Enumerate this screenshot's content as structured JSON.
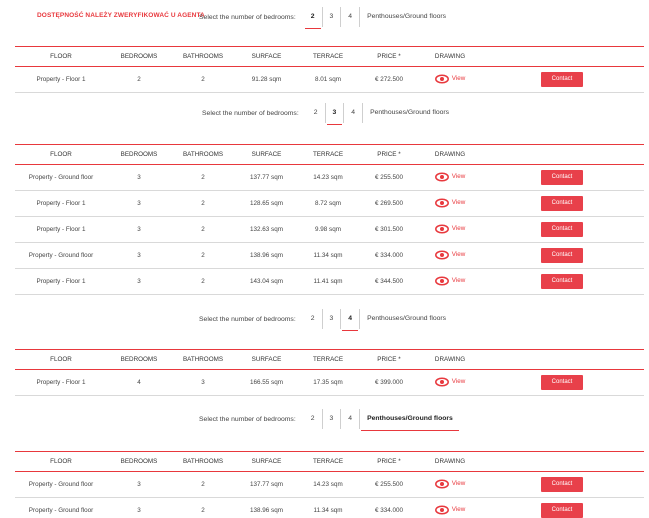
{
  "notice": "DOSTĘPNOŚĆ NALEŻY ZWERYFIKOWAĆ U AGENTA",
  "selector": {
    "label": "Select the number of bedrooms:",
    "options": [
      "2",
      "3",
      "4",
      "Penthouses/Ground floors"
    ]
  },
  "columns": [
    "FLOOR",
    "BEDROOMS",
    "BATHROOMS",
    "SURFACE",
    "TERRACE",
    "PRICE *",
    "DRAWING"
  ],
  "view_label": "View",
  "contact_label": "Contact",
  "sections": [
    {
      "active_option": "2",
      "rows": [
        {
          "floor": "Property - Floor 1",
          "bedrooms": "2",
          "bathrooms": "2",
          "surface": "91.28 sqm",
          "terrace": "8.01 sqm",
          "price": "€ 272.500"
        }
      ]
    },
    {
      "active_option": "3",
      "rows": [
        {
          "floor": "Property - Ground floor",
          "bedrooms": "3",
          "bathrooms": "2",
          "surface": "137.77 sqm",
          "terrace": "14.23 sqm",
          "price": "€ 255.500"
        },
        {
          "floor": "Property - Floor 1",
          "bedrooms": "3",
          "bathrooms": "2",
          "surface": "128.65 sqm",
          "terrace": "8.72 sqm",
          "price": "€ 269.500"
        },
        {
          "floor": "Property - Floor 1",
          "bedrooms": "3",
          "bathrooms": "2",
          "surface": "132.63 sqm",
          "terrace": "9.98 sqm",
          "price": "€ 301.500"
        },
        {
          "floor": "Property - Ground floor",
          "bedrooms": "3",
          "bathrooms": "2",
          "surface": "138.96 sqm",
          "terrace": "11.34 sqm",
          "price": "€ 334.000"
        },
        {
          "floor": "Property - Floor 1",
          "bedrooms": "3",
          "bathrooms": "2",
          "surface": "143.04 sqm",
          "terrace": "11.41 sqm",
          "price": "€ 344.500"
        }
      ]
    },
    {
      "active_option": "4",
      "rows": [
        {
          "floor": "Property - Floor 1",
          "bedrooms": "4",
          "bathrooms": "3",
          "surface": "166.55 sqm",
          "terrace": "17.35 sqm",
          "price": "€ 399.000"
        }
      ]
    },
    {
      "active_option": "Penthouses/Ground floors",
      "rows": [
        {
          "floor": "Property - Ground floor",
          "bedrooms": "3",
          "bathrooms": "2",
          "surface": "137.77 sqm",
          "terrace": "14.23 sqm",
          "price": "€ 255.500"
        },
        {
          "floor": "Property - Ground floor",
          "bedrooms": "3",
          "bathrooms": "2",
          "surface": "138.96 sqm",
          "terrace": "11.34 sqm",
          "price": "€ 334.000"
        }
      ]
    }
  ],
  "colors": {
    "accent": "#e8383d",
    "button": "#e8404a"
  },
  "icons": {
    "view": "eye-icon"
  }
}
